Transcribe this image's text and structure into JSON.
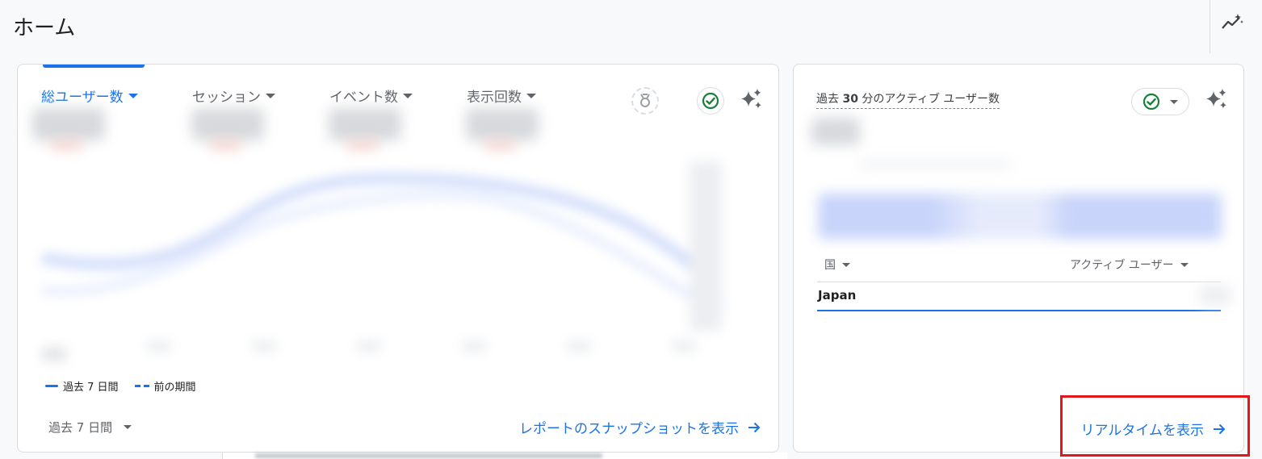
{
  "page": {
    "title": "ホーム"
  },
  "overview_card": {
    "metric_tabs": [
      {
        "label": "総ユーザー数",
        "active": true
      },
      {
        "label": "セッション",
        "active": false
      },
      {
        "label": "イベント数",
        "active": false
      },
      {
        "label": "表示回数",
        "active": false
      }
    ],
    "legend": {
      "current": "過去 7 日間",
      "previous": "前の期間"
    },
    "date_range": "過去 7 日間",
    "snapshot_link": "レポートのスナップショットを表示"
  },
  "realtime_card": {
    "title_prefix": "過去 ",
    "title_value": "30",
    "title_suffix": " 分のアクティブ ユーザー数",
    "table": {
      "col_dimension": "国",
      "col_metric": "アクティブ ユーザー",
      "rows": [
        {
          "country": "Japan"
        }
      ]
    },
    "realtime_link": "リアルタイムを表示"
  },
  "colors": {
    "accent": "#1a73e8",
    "status_green": "#188038",
    "highlight": "#e3161b"
  }
}
